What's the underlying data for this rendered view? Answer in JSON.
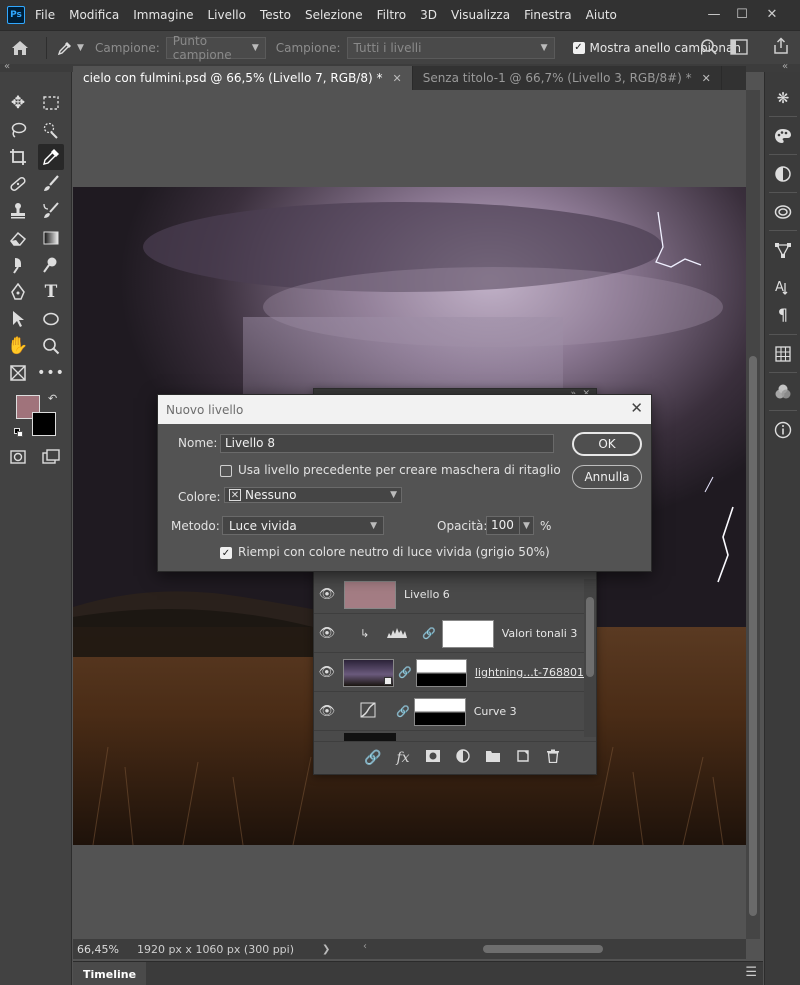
{
  "app": {
    "logo": "Ps"
  },
  "menu": [
    "File",
    "Modifica",
    "Immagine",
    "Livello",
    "Testo",
    "Selezione",
    "Filtro",
    "3D",
    "Visualizza",
    "Finestra",
    "Aiuto"
  ],
  "options_bar": {
    "sample_size_label": "Campione:",
    "sample_size_value": "Punto campione",
    "sample_label": "Campione:",
    "sample_value": "Tutti i livelli",
    "show_ring_label": "Mostra anello campionan",
    "show_ring_checked": true
  },
  "tabs": [
    {
      "label": "cielo con fulmini.psd @ 66,5% (Livello 7, RGB/8) *",
      "active": true
    },
    {
      "label": "Senza titolo-1 @ 66,7% (Livello 3, RGB/8#) *",
      "active": false
    }
  ],
  "colors": {
    "foreground": "#a0737b",
    "background": "#000000",
    "layer6_fill": "#a47d84"
  },
  "layers_panel": {
    "layers": [
      {
        "name": "Livello 6",
        "kind": "fill"
      },
      {
        "name": "Valori tonali 3",
        "kind": "adjustment-levels"
      },
      {
        "name": "lightning...t-768801",
        "kind": "smart-object"
      },
      {
        "name": "Curve 3",
        "kind": "adjustment-curves"
      }
    ],
    "footer_icons": [
      "link-icon",
      "fx-icon",
      "mask-icon",
      "adjustment-icon",
      "folder-icon",
      "new-layer-icon",
      "trash-icon"
    ]
  },
  "dialog": {
    "title": "Nuovo livello",
    "name_label": "Nome:",
    "name_value": "Livello 8",
    "clip_label": "Usa livello precedente per creare maschera di ritaglio",
    "clip_checked": false,
    "color_label": "Colore:",
    "color_value": "Nessuno",
    "mode_label": "Metodo:",
    "mode_value": "Luce vivida",
    "opacity_label": "Opacità:",
    "opacity_value": "100",
    "opacity_unit": "%",
    "fill_label": "Riempi con colore neutro di luce vivida (grigio 50%)",
    "fill_checked": true,
    "ok_label": "OK",
    "cancel_label": "Annulla"
  },
  "status": {
    "zoom": "66,45%",
    "doc_info": "1920 px x 1060 px (300 ppi)"
  },
  "timeline": {
    "label": "Timeline"
  }
}
